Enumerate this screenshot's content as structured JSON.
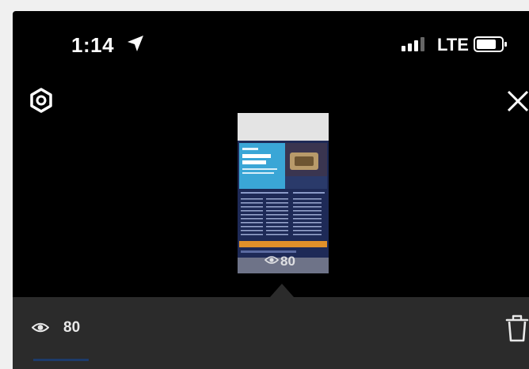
{
  "status_bar": {
    "time": "1:14",
    "network": "LTE",
    "icons": [
      "location-arrow-icon",
      "cellular-signal-icon",
      "battery-icon"
    ]
  },
  "toolbar": {
    "settings_icon": "settings-icon",
    "close_icon": "close-icon"
  },
  "thumbnail": {
    "views": "80",
    "eye_icon": "eye-icon"
  },
  "bottom_bar": {
    "views": "80",
    "eye_icon": "eye-icon",
    "delete_icon": "trash-icon"
  },
  "colors": {
    "background": "#000000",
    "bottom_bar": "#2b2b2b",
    "flyer_navy": "#1e2a57",
    "flyer_cyan": "#3aa6d6",
    "flyer_orange": "#e0902a",
    "tab_indicator": "#1d3b6b"
  }
}
